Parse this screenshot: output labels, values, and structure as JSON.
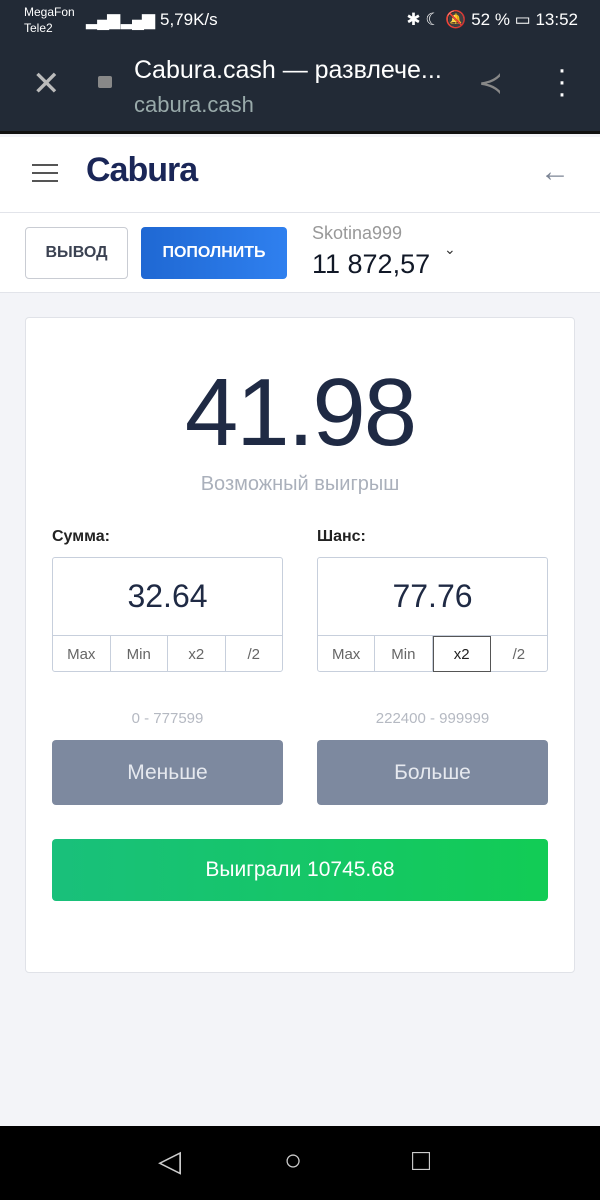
{
  "status": {
    "operator1": "MegaFon",
    "operator2": "Tele2",
    "speed": "5,79K/s",
    "battery": "52 %",
    "time": "13:52"
  },
  "browser": {
    "title": "Cabura.cash — развлече...",
    "url": "cabura.cash"
  },
  "header": {
    "logo": "Cabura"
  },
  "account": {
    "withdraw": "ВЫВОД",
    "deposit": "ПОПОЛНИТЬ",
    "username": "Skotina999",
    "balance": "11 872,57"
  },
  "game": {
    "payout": "41.98",
    "payout_label": "Возможный выигрыш",
    "amount": {
      "label": "Сумма:",
      "value": "32.64",
      "buttons": [
        "Max",
        "Min",
        "x2",
        "/2"
      ]
    },
    "chance": {
      "label": "Шанс:",
      "value": "77.76",
      "buttons": [
        "Max",
        "Min",
        "x2",
        "/2"
      ]
    },
    "low_range": "0 - 777599",
    "high_range": "222400 - 999999",
    "low_button": "Меньше",
    "high_button": "Больше",
    "result": "Выиграли 10745.68"
  }
}
